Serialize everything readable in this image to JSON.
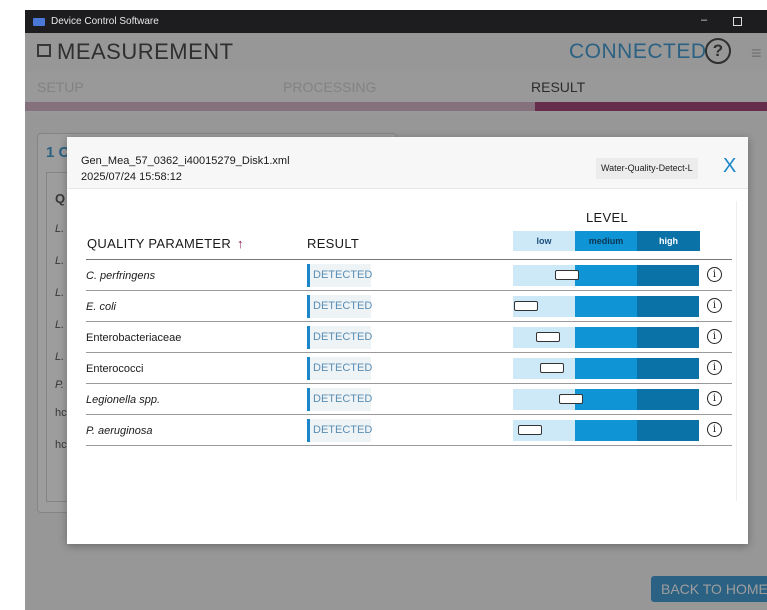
{
  "window": {
    "title": "Device Control Software"
  },
  "header": {
    "title": "MEASUREMENT",
    "status": "CONNECTED",
    "help_glyph": "?",
    "menu_glyph": "≡"
  },
  "steps": [
    {
      "label": "SETUP"
    },
    {
      "label": "PROCESSING"
    },
    {
      "label": "RESULT"
    }
  ],
  "background": {
    "card_number": "1 C",
    "rows": [
      "Q",
      "L.",
      "L.",
      "L.",
      "L.",
      "L.",
      "P.",
      "hc",
      "hc"
    ]
  },
  "footer": {
    "back_label": "BACK TO HOME"
  },
  "modal": {
    "filename": "Gen_Mea_57_0362_i40015279_Disk1.xml",
    "datetime": "2025/07/24 15:58:12",
    "tag": "Water-Quality-Detect-L",
    "close_label": "X",
    "columns": {
      "parameter": "QUALITY PARAMETER",
      "sort_glyph": "↑",
      "result": "RESULT",
      "level": "LEVEL"
    },
    "level_labels": {
      "low": "low",
      "medium": "medium",
      "high": "high"
    },
    "info_glyph": "i",
    "rows": [
      {
        "parameter": "C. perfringens",
        "italic": true,
        "result": "DETECTED",
        "level": 0.29
      },
      {
        "parameter": "E. coli",
        "italic": true,
        "result": "DETECTED",
        "level": 0.07
      },
      {
        "parameter": "Enterobacteriaceae",
        "italic": false,
        "result": "DETECTED",
        "level": 0.19
      },
      {
        "parameter": "Enterococci",
        "italic": false,
        "result": "DETECTED",
        "level": 0.21
      },
      {
        "parameter": "Legionella spp.",
        "italic": true,
        "result": "DETECTED",
        "level": 0.31
      },
      {
        "parameter": "P. aeruginosa",
        "italic": true,
        "result": "DETECTED",
        "level": 0.09
      }
    ]
  }
}
